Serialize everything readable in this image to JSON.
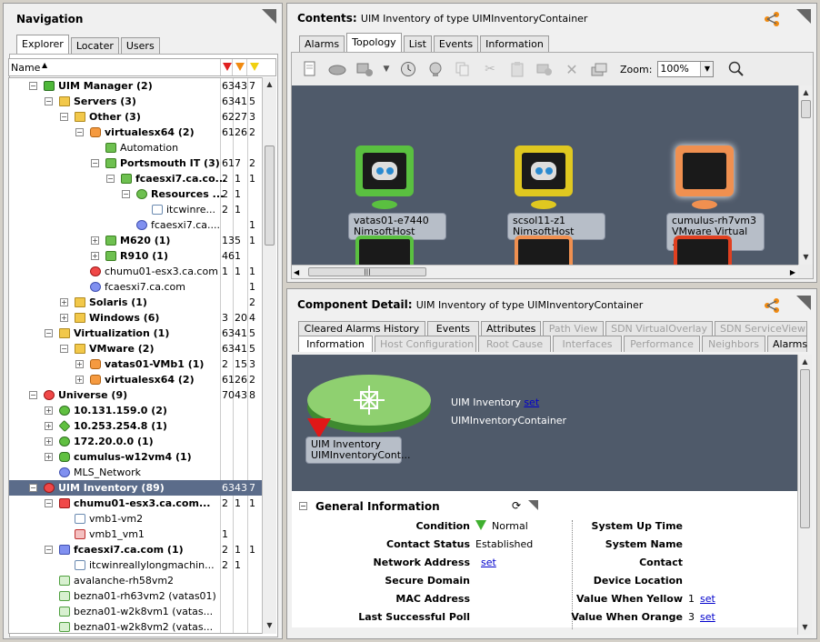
{
  "nav": {
    "title": "Navigation",
    "tabs": [
      "Explorer",
      "Locater",
      "Users"
    ],
    "col_name": "Name",
    "tree": [
      {
        "label": "UIM Manager",
        "count": "(2)",
        "c1": "63",
        "c2": "43",
        "c3": "7",
        "lvl": 1,
        "exp": "−",
        "icon": "green-sq",
        "bold": true
      },
      {
        "label": "Servers",
        "count": "(3)",
        "c1": "63",
        "c2": "41",
        "c3": "5",
        "lvl": 2,
        "exp": "−",
        "icon": "folder",
        "bold": true
      },
      {
        "label": "Other",
        "count": "(3)",
        "c1": "62",
        "c2": "27",
        "c3": "3",
        "lvl": 3,
        "exp": "−",
        "icon": "folder",
        "bold": true
      },
      {
        "label": "virtualesx64",
        "count": "(2)",
        "c1": "61",
        "c2": "26",
        "c3": "2",
        "lvl": 4,
        "exp": "−",
        "icon": "orange",
        "bold": true
      },
      {
        "label": "Automation",
        "count": "",
        "c1": "",
        "c2": "",
        "c3": "",
        "lvl": 5,
        "exp": "",
        "icon": "green-cube",
        "bold": false
      },
      {
        "label": "Portsmouth IT",
        "count": "(3)",
        "c1": "61",
        "c2": "7",
        "c3": "2",
        "lvl": 5,
        "exp": "−",
        "icon": "green-cube",
        "bold": true
      },
      {
        "label": "fcaesxi7.ca.co...",
        "count": "",
        "c1": "2",
        "c2": "1",
        "c3": "1",
        "lvl": 6,
        "exp": "−",
        "icon": "green-cube",
        "bold": true
      },
      {
        "label": "Resources ...",
        "count": "",
        "c1": "2",
        "c2": "1",
        "c3": "",
        "lvl": 7,
        "exp": "−",
        "icon": "green-db",
        "bold": true
      },
      {
        "label": "itcwinre...",
        "count": "",
        "c1": "2",
        "c2": "1",
        "c3": "",
        "lvl": 8,
        "exp": "",
        "icon": "vm",
        "bold": false
      },
      {
        "label": "fcaesxi7.ca....",
        "count": "",
        "c1": "",
        "c2": "",
        "c3": "1",
        "lvl": 7,
        "exp": "",
        "icon": "blue",
        "bold": false
      },
      {
        "label": "M620",
        "count": "(1)",
        "c1": "13",
        "c2": "5",
        "c3": "1",
        "lvl": 5,
        "exp": "+",
        "icon": "green-cube",
        "bold": true
      },
      {
        "label": "R910",
        "count": "(1)",
        "c1": "46",
        "c2": "1",
        "c3": "",
        "lvl": 5,
        "exp": "+",
        "icon": "green-cube",
        "bold": true
      },
      {
        "label": "chumu01-esx3.ca.com",
        "count": "",
        "c1": "1",
        "c2": "1",
        "c3": "1",
        "lvl": 4,
        "exp": "",
        "icon": "red",
        "bold": false
      },
      {
        "label": "fcaesxi7.ca.com",
        "count": "",
        "c1": "",
        "c2": "",
        "c3": "1",
        "lvl": 4,
        "exp": "",
        "icon": "blue",
        "bold": false
      },
      {
        "label": "Solaris",
        "count": "(1)",
        "c1": "",
        "c2": "",
        "c3": "2",
        "lvl": 3,
        "exp": "+",
        "icon": "folder",
        "bold": true
      },
      {
        "label": "Windows",
        "count": "(6)",
        "c1": "3",
        "c2": "20",
        "c3": "4",
        "lvl": 3,
        "exp": "+",
        "icon": "folder",
        "bold": true
      },
      {
        "label": "Virtualization",
        "count": "(1)",
        "c1": "63",
        "c2": "41",
        "c3": "5",
        "lvl": 2,
        "exp": "−",
        "icon": "folder",
        "bold": true
      },
      {
        "label": "VMware",
        "count": "(2)",
        "c1": "63",
        "c2": "41",
        "c3": "5",
        "lvl": 3,
        "exp": "−",
        "icon": "folder",
        "bold": true
      },
      {
        "label": "vatas01-VMb1",
        "count": "(1)",
        "c1": "2",
        "c2": "15",
        "c3": "3",
        "lvl": 4,
        "exp": "+",
        "icon": "orange",
        "bold": true
      },
      {
        "label": "virtualesx64",
        "count": "(2)",
        "c1": "61",
        "c2": "26",
        "c3": "2",
        "lvl": 4,
        "exp": "+",
        "icon": "orange",
        "bold": true
      },
      {
        "label": "Universe",
        "count": "(9)",
        "c1": "70",
        "c2": "43",
        "c3": "8",
        "lvl": 1,
        "exp": "−",
        "icon": "red",
        "bold": true
      },
      {
        "label": "10.131.159.0",
        "count": "(2)",
        "c1": "",
        "c2": "",
        "c3": "",
        "lvl": 2,
        "exp": "+",
        "icon": "green-ov",
        "bold": true
      },
      {
        "label": "10.253.254.8",
        "count": "(1)",
        "c1": "",
        "c2": "",
        "c3": "",
        "lvl": 2,
        "exp": "+",
        "icon": "green-dia",
        "bold": true
      },
      {
        "label": "172.20.0.0",
        "count": "(1)",
        "c1": "",
        "c2": "",
        "c3": "",
        "lvl": 2,
        "exp": "+",
        "icon": "green-ov",
        "bold": true
      },
      {
        "label": "cumulus-w12vm4",
        "count": "(1)",
        "c1": "",
        "c2": "",
        "c3": "",
        "lvl": 2,
        "exp": "+",
        "icon": "green-hex",
        "bold": true
      },
      {
        "label": "MLS_Network",
        "count": "",
        "c1": "",
        "c2": "",
        "c3": "",
        "lvl": 2,
        "exp": "",
        "icon": "blue",
        "bold": false
      },
      {
        "label": "UIM Inventory",
        "count": "(89)",
        "c1": "63",
        "c2": "43",
        "c3": "7",
        "lvl": 1,
        "exp": "−",
        "icon": "red",
        "bold": true,
        "sel": true
      },
      {
        "label": "chumu01-esx3.ca.com...",
        "count": "",
        "c1": "2",
        "c2": "1",
        "c3": "1",
        "lvl": 2,
        "exp": "−",
        "icon": "red-sq",
        "bold": true
      },
      {
        "label": "vmb1-vm2",
        "count": "",
        "c1": "",
        "c2": "",
        "c3": "",
        "lvl": 3,
        "exp": "",
        "icon": "vm",
        "bold": false
      },
      {
        "label": "vmb1_vm1",
        "count": "",
        "c1": "1",
        "c2": "",
        "c3": "",
        "lvl": 3,
        "exp": "",
        "icon": "vm-red",
        "bold": false
      },
      {
        "label": "fcaesxi7.ca.com",
        "count": "(1)",
        "c1": "2",
        "c2": "1",
        "c3": "1",
        "lvl": 2,
        "exp": "−",
        "icon": "blue-sq",
        "bold": true
      },
      {
        "label": "itcwinreallylongmachin...",
        "count": "",
        "c1": "2",
        "c2": "1",
        "c3": "",
        "lvl": 3,
        "exp": "",
        "icon": "vm",
        "bold": false
      },
      {
        "label": "avalanche-rh58vm2",
        "count": "",
        "c1": "",
        "c2": "",
        "c3": "",
        "lvl": 2,
        "exp": "",
        "icon": "vm-green",
        "bold": false
      },
      {
        "label": "bezna01-rh63vm2 (vatas01)",
        "count": "",
        "c1": "",
        "c2": "",
        "c3": "",
        "lvl": 2,
        "exp": "",
        "icon": "vm-green",
        "bold": false
      },
      {
        "label": "bezna01-w2k8vm1 (vatas...",
        "count": "",
        "c1": "",
        "c2": "",
        "c3": "",
        "lvl": 2,
        "exp": "",
        "icon": "vm-green",
        "bold": false
      },
      {
        "label": "bezna01-w2k8vm2 (vatas...",
        "count": "",
        "c1": "",
        "c2": "",
        "c3": "",
        "lvl": 2,
        "exp": "",
        "icon": "vm-green",
        "bold": false
      }
    ]
  },
  "contents": {
    "title": "Contents:",
    "subtitle": "UIM Inventory of type UIMInventoryContainer",
    "tabs": [
      "Alarms",
      "Topology",
      "List",
      "Events",
      "Information"
    ],
    "zoom_label": "Zoom:",
    "zoom_value": "100%",
    "nodes": [
      {
        "line1": "vatas01-e7440",
        "line2": "NimsoftHost"
      },
      {
        "line1": "scsol11-z1",
        "line2": "NimsoftHost"
      },
      {
        "line1": "cumulus-rh7vm3",
        "line2": "VMware Virtual ..."
      }
    ]
  },
  "detail": {
    "title": "Component Detail:",
    "subtitle": "UIM Inventory of type UIMInventoryContainer",
    "tabs_top": [
      "Cleared Alarms History",
      "Events",
      "Attributes",
      "Path View",
      "SDN VirtualOverlay",
      "SDN ServiceView"
    ],
    "tabs_bottom": [
      "Information",
      "Host Configuration",
      "Root Cause",
      "Interfaces",
      "Performance",
      "Neighbors",
      "Alarms"
    ],
    "node_line1": "UIM Inventory",
    "node_line2": "UIMInventoryCont...",
    "name": "UIM Inventory",
    "name_set": "set",
    "type": "UIMInventoryContainer",
    "section": "General Information",
    "left": [
      {
        "label": "Condition",
        "value": "Normal",
        "link": ""
      },
      {
        "label": "Contact Status",
        "value": "Established",
        "link": ""
      },
      {
        "label": "Network Address",
        "value": "",
        "link": "set"
      },
      {
        "label": "Secure Domain",
        "value": "",
        "link": ""
      },
      {
        "label": "MAC Address",
        "value": "",
        "link": ""
      },
      {
        "label": "Last Successful Poll",
        "value": "",
        "link": ""
      }
    ],
    "right": [
      {
        "label": "System Up Time",
        "value": "",
        "link": ""
      },
      {
        "label": "System Name",
        "value": "",
        "link": ""
      },
      {
        "label": "Contact",
        "value": "",
        "link": ""
      },
      {
        "label": "Device Location",
        "value": "",
        "link": ""
      },
      {
        "label": "Value When Yellow",
        "value": "1",
        "link": "set"
      },
      {
        "label": "Value When Orange",
        "value": "3",
        "link": "set"
      }
    ]
  }
}
